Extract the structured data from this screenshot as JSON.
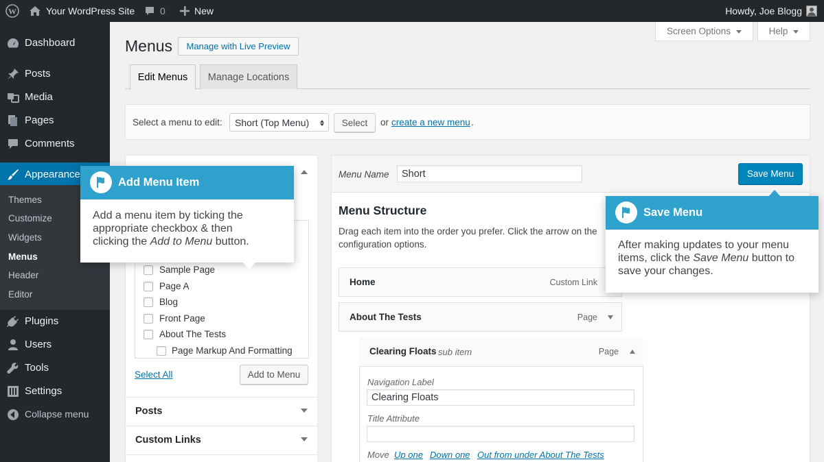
{
  "adminbar": {
    "site_name": "Your WordPress Site",
    "comments_count": "0",
    "new_label": "New",
    "howdy": "Howdy, Joe Blogg"
  },
  "sidebar": {
    "items": [
      {
        "label": "Dashboard",
        "icon": "dashboard-icon"
      },
      {
        "label": "Posts",
        "icon": "pin-icon"
      },
      {
        "label": "Media",
        "icon": "media-icon"
      },
      {
        "label": "Pages",
        "icon": "pages-icon"
      },
      {
        "label": "Comments",
        "icon": "comment-icon"
      },
      {
        "label": "Appearance",
        "icon": "brush-icon"
      },
      {
        "label": "Plugins",
        "icon": "plugin-icon"
      },
      {
        "label": "Users",
        "icon": "users-icon"
      },
      {
        "label": "Tools",
        "icon": "wrench-icon"
      },
      {
        "label": "Settings",
        "icon": "settings-icon"
      }
    ],
    "submenu": [
      "Themes",
      "Customize",
      "Widgets",
      "Menus",
      "Header",
      "Editor"
    ],
    "collapse_label": "Collapse menu"
  },
  "header": {
    "screen_options": "Screen Options",
    "help": "Help",
    "page_title": "Menus",
    "live_preview": "Manage with Live Preview"
  },
  "tabs": [
    "Edit Menus",
    "Manage Locations"
  ],
  "select_bar": {
    "label": "Select a menu to edit:",
    "selected": "Short (Top Menu)",
    "select_button": "Select",
    "or_text": "or",
    "create_link": "create a new menu",
    "period": "."
  },
  "left_panel": {
    "pages": [
      "Sample Page",
      "Page A",
      "Blog",
      "Front Page",
      "About The Tests",
      "Page Markup And Formatting"
    ],
    "select_all": "Select All",
    "add_to_menu": "Add to Menu",
    "accordions": [
      "Posts",
      "Custom Links"
    ]
  },
  "right_panel": {
    "menu_name_label": "Menu Name",
    "menu_name_value": "Short",
    "save_menu": "Save Menu",
    "structure_title": "Menu Structure",
    "structure_desc_line1": "Drag each item into the order you prefer. Click the arrow on the",
    "structure_desc_line2": "configuration options.",
    "items": [
      {
        "title": "Home",
        "type": "Custom Link"
      },
      {
        "title": "About The Tests",
        "type": "Page"
      },
      {
        "title": "Clearing Floats",
        "subtitle": "sub item",
        "type": "Page"
      }
    ],
    "nav_label_label": "Navigation Label",
    "nav_label_value": "Clearing Floats",
    "title_attr_label": "Title Attribute",
    "move_label": "Move",
    "move_links": [
      "Up one",
      "Down one",
      "Out from under About The Tests"
    ]
  },
  "pointers": {
    "add": {
      "title": "Add Menu Item",
      "line1": "Add a menu item by ticking the",
      "line2": "appropriate checkbox & then",
      "line3_pre": "clicking the ",
      "line3_em": "Add to Menu",
      "line3_post": " button."
    },
    "save": {
      "title": "Save Menu",
      "line1": "After making updates to your menu",
      "line2_pre": "items, click the ",
      "line2_em": "Save Menu",
      "line2_post": " button to",
      "line3": "save your changes."
    }
  },
  "colors": {
    "accent": "#0073aa",
    "pointer_header": "#2ea2cc",
    "admin_dark": "#23282d"
  }
}
